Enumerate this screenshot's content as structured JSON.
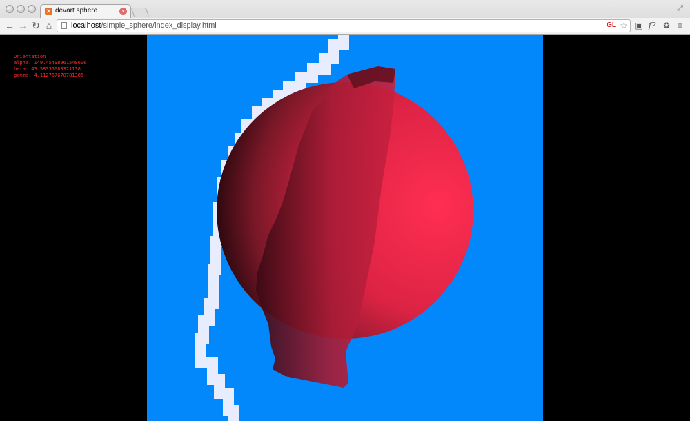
{
  "browser": {
    "tab_title": "devart sphere",
    "url_host": "localhost",
    "url_path": "/simple_sphere/index_display.html",
    "gl_badge": "GL",
    "extension_f_label": "f?"
  },
  "hud": {
    "heading": "Orientation",
    "alpha": "alpha: 149.45498961548606",
    "beta": "beta: 43.58335083321138",
    "gamma": "gamma: 4.112767670781385"
  },
  "scene": {
    "background_color": "#0288fb",
    "sphere_color": "#ff2e52",
    "trail_color": "#e8ecff"
  }
}
